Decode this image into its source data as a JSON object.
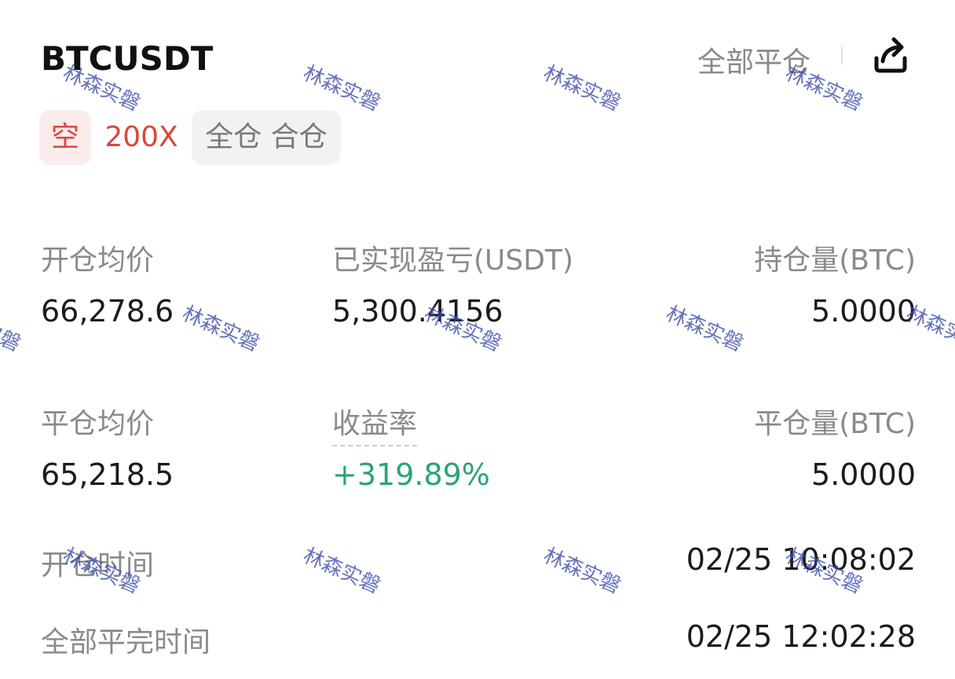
{
  "header": {
    "symbol": "BTCUSDT",
    "close_all_label": "全部平仓",
    "share_icon": "share-icon"
  },
  "tags": {
    "direction": "空",
    "leverage": "200X",
    "margin_mode": "全仓 合仓"
  },
  "stats": {
    "open_avg_price_label": "开仓均价",
    "open_avg_price_value": "66,278.6",
    "realized_pnl_label": "已实现盈亏(USDT)",
    "realized_pnl_value": "5,300.4156",
    "position_size_label": "持仓量(BTC)",
    "position_size_value": "5.0000",
    "close_avg_price_label": "平仓均价",
    "close_avg_price_value": "65,218.5",
    "roi_label": "收益率",
    "roi_value": "+319.89%",
    "closed_size_label": "平仓量(BTC)",
    "closed_size_value": "5.0000",
    "open_time_label": "开仓时间",
    "open_time_value": "02/25 10:08:02",
    "full_close_time_label": "全部平完时间",
    "full_close_time_value": "02/25 12:02:28"
  },
  "watermark": {
    "text": "林森实磐"
  },
  "colors": {
    "short_red": "#d7473f",
    "profit_green": "#2aa37a",
    "label_gray": "#8a8a8a",
    "watermark_blue": "#3a4ba8"
  }
}
